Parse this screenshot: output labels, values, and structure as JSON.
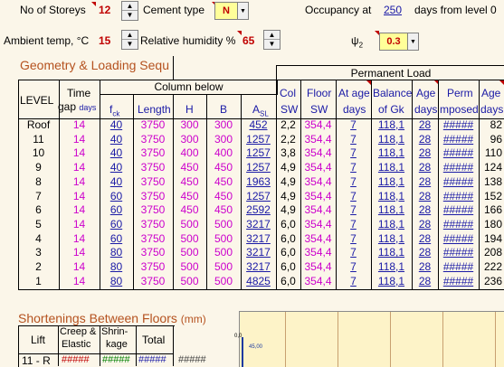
{
  "top": {
    "storeys_label": "No of Storeys",
    "storeys_value": "12",
    "cement_label": "Cement type",
    "cement_value": "N",
    "occupancy_label": "Occupancy at",
    "occupancy_value": "250",
    "occupancy_suffix": "days from level 0",
    "ambient_label": "Ambient temp, °C",
    "ambient_value": "15",
    "humidity_label": "Relative humidity %",
    "humidity_value": "65",
    "psi_label": "ψ",
    "psi_sub": "2",
    "psi_value": "0.3"
  },
  "geometry_title": "Geometry & Loading Sequ",
  "headers": {
    "permanent_load": "Permanent Load",
    "level": "LEVEL",
    "time": "Time",
    "gap": "gap",
    "days_small": "days",
    "column_below": "Column below",
    "fck": "f",
    "fck_sub": "ck",
    "length": "Length",
    "h": "H",
    "b": "B",
    "asl": "A",
    "asl_sub": "SL",
    "col": "Col",
    "sw": "SW",
    "floor": "Floor",
    "floor_sw": "SW",
    "at_age": "At age",
    "at_age_days": "days",
    "balance": "Balance",
    "of_gk": "of Gk",
    "age": "Age",
    "age_days": "days",
    "perm": "Perm",
    "imposed": "mposed",
    "age2": "Age",
    "age2_days": "days"
  },
  "rows": [
    {
      "level": "Roof",
      "gap": "14",
      "fck": "40",
      "len": "3750",
      "h": "300",
      "b": "300",
      "asl": "452",
      "col": "2,2",
      "floor": "354,4",
      "atage": "7",
      "bal": "118,1",
      "age": "28",
      "perm": "#####",
      "age2": "82"
    },
    {
      "level": "11",
      "gap": "14",
      "fck": "40",
      "len": "3750",
      "h": "300",
      "b": "300",
      "asl": "1257",
      "col": "2,2",
      "floor": "354,4",
      "atage": "7",
      "bal": "118,1",
      "age": "28",
      "perm": "#####",
      "age2": "96"
    },
    {
      "level": "10",
      "gap": "14",
      "fck": "40",
      "len": "3750",
      "h": "400",
      "b": "400",
      "asl": "1257",
      "col": "3,8",
      "floor": "354,4",
      "atage": "7",
      "bal": "118,1",
      "age": "28",
      "perm": "#####",
      "age2": "110"
    },
    {
      "level": "9",
      "gap": "14",
      "fck": "40",
      "len": "3750",
      "h": "450",
      "b": "450",
      "asl": "1257",
      "col": "4,9",
      "floor": "354,4",
      "atage": "7",
      "bal": "118,1",
      "age": "28",
      "perm": "#####",
      "age2": "124"
    },
    {
      "level": "8",
      "gap": "14",
      "fck": "40",
      "len": "3750",
      "h": "450",
      "b": "450",
      "asl": "1963",
      "col": "4,9",
      "floor": "354,4",
      "atage": "7",
      "bal": "118,1",
      "age": "28",
      "perm": "#####",
      "age2": "138"
    },
    {
      "level": "7",
      "gap": "14",
      "fck": "60",
      "len": "3750",
      "h": "450",
      "b": "450",
      "asl": "1257",
      "col": "4,9",
      "floor": "354,4",
      "atage": "7",
      "bal": "118,1",
      "age": "28",
      "perm": "#####",
      "age2": "152"
    },
    {
      "level": "6",
      "gap": "14",
      "fck": "60",
      "len": "3750",
      "h": "450",
      "b": "450",
      "asl": "2592",
      "col": "4,9",
      "floor": "354,4",
      "atage": "7",
      "bal": "118,1",
      "age": "28",
      "perm": "#####",
      "age2": "166"
    },
    {
      "level": "5",
      "gap": "14",
      "fck": "60",
      "len": "3750",
      "h": "500",
      "b": "500",
      "asl": "3217",
      "col": "6,0",
      "floor": "354,4",
      "atage": "7",
      "bal": "118,1",
      "age": "28",
      "perm": "#####",
      "age2": "180"
    },
    {
      "level": "4",
      "gap": "14",
      "fck": "60",
      "len": "3750",
      "h": "500",
      "b": "500",
      "asl": "3217",
      "col": "6,0",
      "floor": "354,4",
      "atage": "7",
      "bal": "118,1",
      "age": "28",
      "perm": "#####",
      "age2": "194"
    },
    {
      "level": "3",
      "gap": "14",
      "fck": "80",
      "len": "3750",
      "h": "500",
      "b": "500",
      "asl": "3217",
      "col": "6,0",
      "floor": "354,4",
      "atage": "7",
      "bal": "118,1",
      "age": "28",
      "perm": "#####",
      "age2": "208"
    },
    {
      "level": "2",
      "gap": "14",
      "fck": "80",
      "len": "3750",
      "h": "500",
      "b": "500",
      "asl": "3217",
      "col": "6,0",
      "floor": "354,4",
      "atage": "7",
      "bal": "118,1",
      "age": "28",
      "perm": "#####",
      "age2": "222"
    },
    {
      "level": "1",
      "gap": "14",
      "fck": "80",
      "len": "3750",
      "h": "500",
      "b": "500",
      "asl": "4825",
      "col": "6,0",
      "floor": "354,4",
      "atage": "7",
      "bal": "118,1",
      "age": "28",
      "perm": "#####",
      "age2": "236"
    }
  ],
  "shortenings": {
    "title": "Shortenings Between Floors",
    "units": "(mm)",
    "lift": "Lift",
    "creep_1": "Creep &",
    "creep_2": "Elastic",
    "shrink_1": "Shrin-",
    "shrink_2": "kage",
    "total": "Total",
    "row_lift": "11 - R",
    "row_creep": "#####",
    "row_shrink": "#####",
    "row_total": "#####",
    "row_extra": "#####"
  },
  "chart": {
    "axis_label": "0,0",
    "point_label": "45,00"
  },
  "colors": {
    "magenta": "#cc00cc",
    "link_blue": "#1a1aa6",
    "red_value": "#c00000",
    "title_orange": "#b5521f",
    "background": "#fbf6e9"
  }
}
